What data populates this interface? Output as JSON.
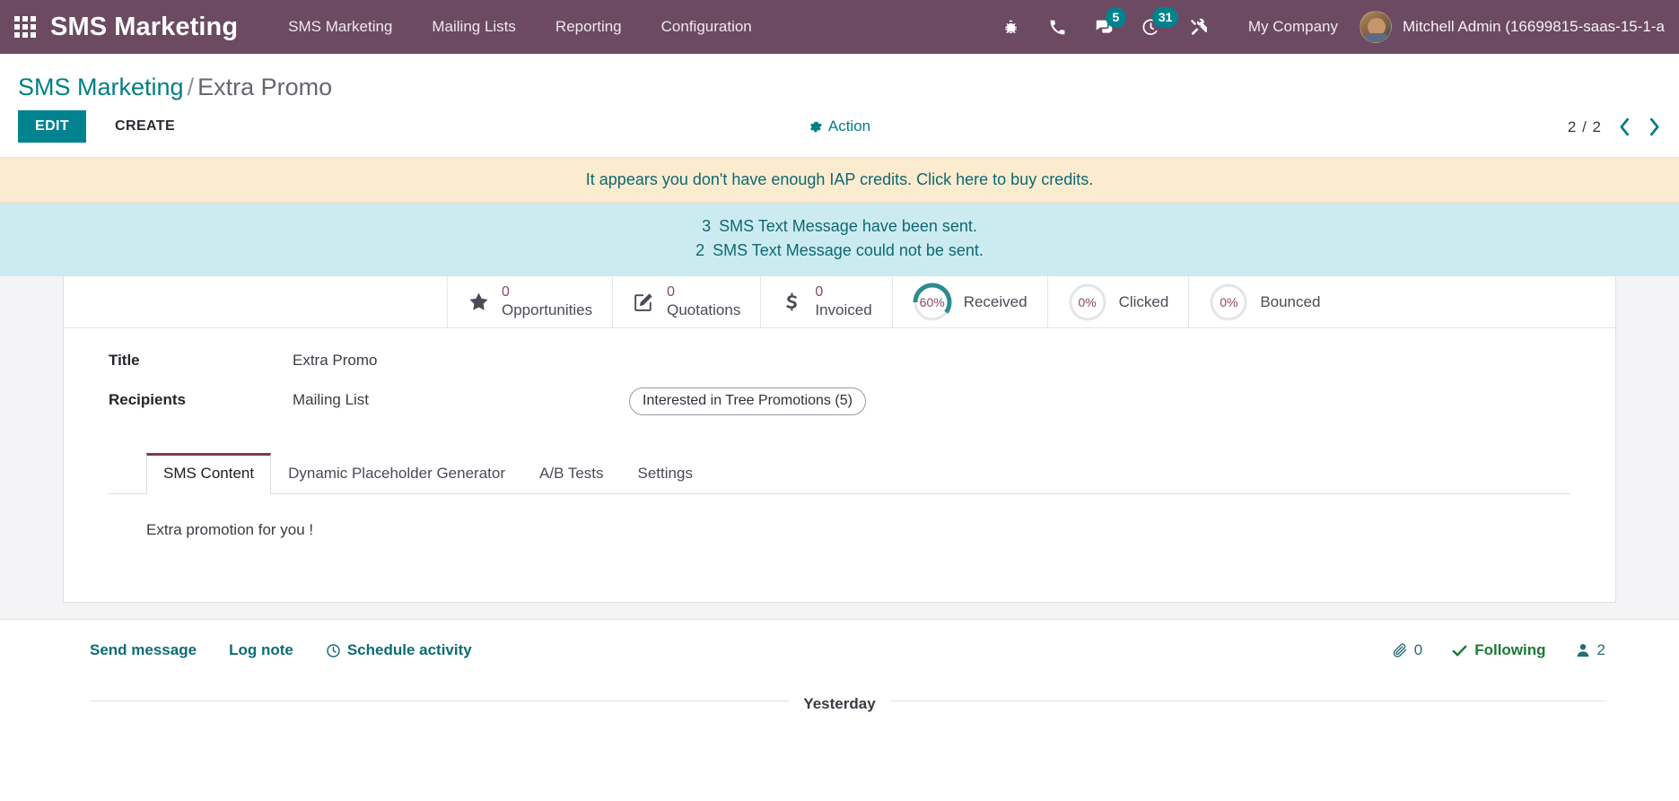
{
  "navbar": {
    "apps_icon": "apps-grid-icon",
    "brand": "SMS Marketing",
    "menu": [
      {
        "label": "SMS Marketing"
      },
      {
        "label": "Mailing Lists"
      },
      {
        "label": "Reporting"
      },
      {
        "label": "Configuration"
      }
    ],
    "systray": [
      {
        "icon": "bug-icon",
        "badge": ""
      },
      {
        "icon": "phone-icon",
        "badge": ""
      },
      {
        "icon": "messages-icon",
        "badge": "5"
      },
      {
        "icon": "activity-clock-icon",
        "badge": "31"
      },
      {
        "icon": "tools-icon",
        "badge": ""
      }
    ],
    "company": "My Company",
    "user": "Mitchell Admin (16699815-saas-15-1-a",
    "badge_color": "#00828f",
    "bar_color": "#6b4a62"
  },
  "breadcrumb": {
    "root": "SMS Marketing",
    "separator": "/",
    "current": "Extra Promo"
  },
  "control_panel": {
    "edit_label": "EDIT",
    "create_label": "CREATE",
    "action_label": "Action",
    "action_icon": "gear-icon",
    "pager_value": "2 / 2",
    "prev_icon": "chevron-left-icon",
    "next_icon": "chevron-right-icon",
    "accent_color": "#00828f"
  },
  "alerts": {
    "warning": "It appears you don't have enough IAP credits. Click here to buy credits.",
    "info_line_1_count": "3",
    "info_line_1_text": "SMS Text Message have been sent.",
    "info_line_2_count": "2",
    "info_line_2_text": "SMS Text Message could not be sent."
  },
  "stats": [
    {
      "icon": "star-icon",
      "value": "0",
      "label": "Opportunities"
    },
    {
      "icon": "quotation-pencil-icon",
      "value": "0",
      "label": "Quotations"
    },
    {
      "icon": "dollar-icon",
      "value": "0",
      "label": "Invoiced"
    }
  ],
  "gauges": [
    {
      "icon": "donut-gauge-icon",
      "percent": "60%",
      "value": 60,
      "label": "Received",
      "color": "#2e8b8f"
    },
    {
      "icon": "donut-gauge-icon",
      "percent": "0%",
      "value": 0,
      "label": "Clicked",
      "color": "#2e8b8f"
    },
    {
      "icon": "donut-gauge-icon",
      "percent": "0%",
      "value": 0,
      "label": "Bounced",
      "color": "#2e8b8f"
    }
  ],
  "form": {
    "title_label": "Title",
    "title_value": "Extra Promo",
    "recipients_label": "Recipients",
    "recipients_value": "Mailing List",
    "mailing_list_tag": "Interested in Tree Promotions (5)"
  },
  "notebook": {
    "tabs": [
      {
        "label": "SMS Content",
        "active": true
      },
      {
        "label": "Dynamic Placeholder Generator",
        "active": false
      },
      {
        "label": "A/B Tests",
        "active": false
      },
      {
        "label": "Settings",
        "active": false
      }
    ],
    "content": "Extra promotion for you !",
    "active_tab_border_color": "#7d3b4e"
  },
  "chatter": {
    "send_message": "Send message",
    "log_note": "Log note",
    "schedule_activity": "Schedule activity",
    "schedule_icon": "clock-icon",
    "attachment_icon": "paperclip-icon",
    "attachment_count": "0",
    "following_icon": "check-icon",
    "following_label": "Following",
    "followers_icon": "user-icon",
    "followers_count": "2",
    "date_separator": "Yesterday"
  }
}
